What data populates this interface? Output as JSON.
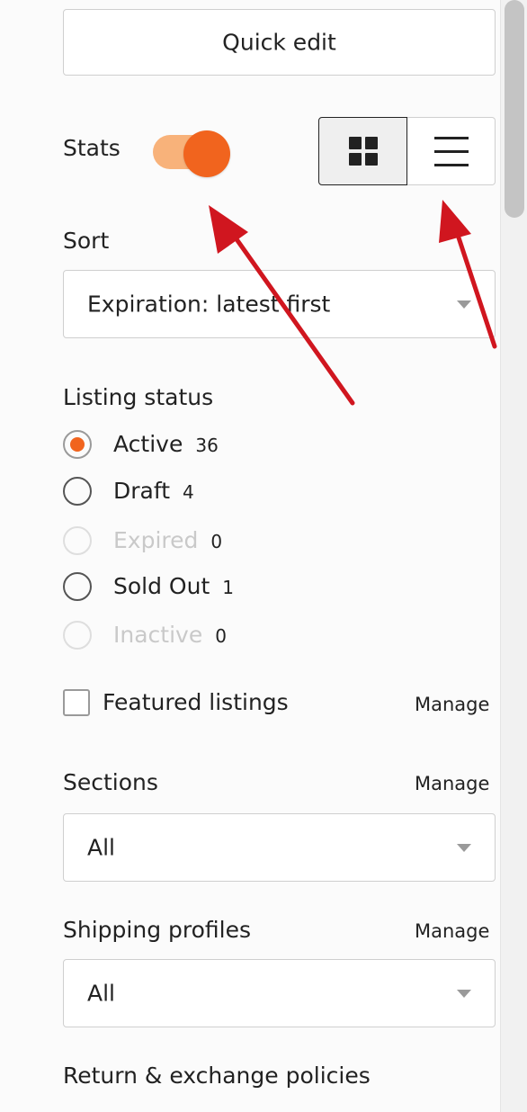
{
  "quick_edit_label": "Quick edit",
  "stats": {
    "label": "Stats",
    "enabled": true,
    "toggle_color": "#f1641e"
  },
  "view_toggle": {
    "grid_icon": "grid-icon",
    "list_icon": "list-icon",
    "selected": "grid"
  },
  "sort": {
    "label": "Sort",
    "value": "Expiration: latest first"
  },
  "listing_status": {
    "label": "Listing status",
    "options": [
      {
        "label": "Active",
        "count": "36",
        "selected": true,
        "disabled": false
      },
      {
        "label": "Draft",
        "count": "4",
        "selected": false,
        "disabled": false
      },
      {
        "label": "Expired",
        "count": "0",
        "selected": false,
        "disabled": true
      },
      {
        "label": "Sold Out",
        "count": "1",
        "selected": false,
        "disabled": false
      },
      {
        "label": "Inactive",
        "count": "0",
        "selected": false,
        "disabled": true
      }
    ]
  },
  "featured": {
    "label": "Featured listings",
    "manage": "Manage",
    "checked": false
  },
  "sections": {
    "label": "Sections",
    "manage": "Manage",
    "value": "All"
  },
  "shipping": {
    "label": "Shipping profiles",
    "manage": "Manage",
    "value": "All"
  },
  "returns": {
    "label": "Return & exchange policies"
  },
  "colors": {
    "accent": "#f1641e",
    "arrow": "#d0161f"
  }
}
